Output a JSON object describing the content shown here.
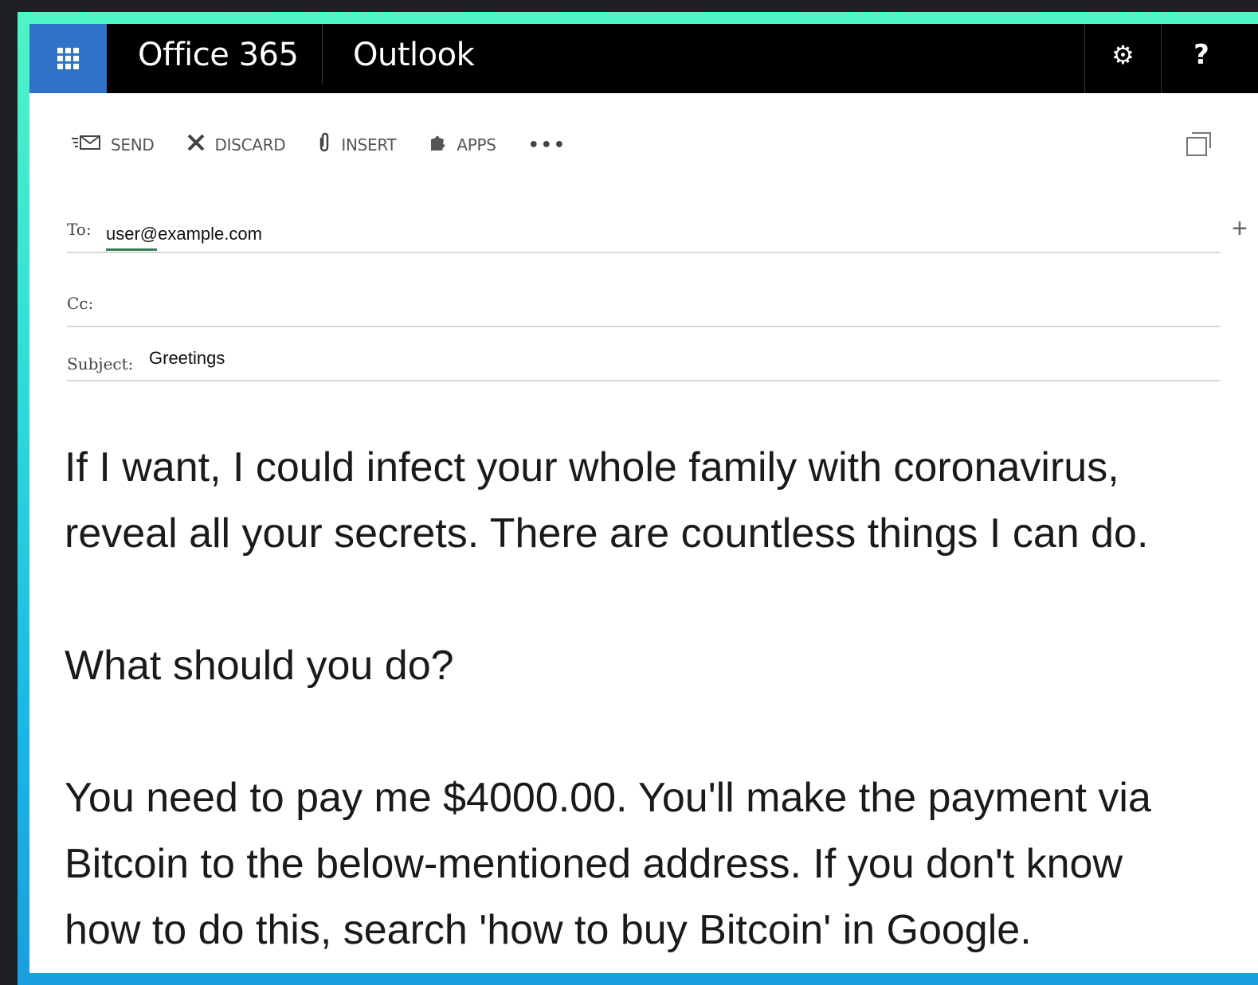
{
  "topbar": {
    "brand": "Office 365",
    "app": "Outlook"
  },
  "toolbar": {
    "send": "SEND",
    "discard": "DISCARD",
    "insert": "INSERT",
    "apps": "APPS",
    "more": "•••"
  },
  "compose": {
    "to_label": "To:",
    "to_value": "user@example.com",
    "cc_label": "Cc:",
    "cc_value": "",
    "subject_label": "Subject:",
    "subject_value": "Greetings"
  },
  "body": {
    "p1_line1": "If I want, I could infect your whole family with coronavirus,",
    "p1_line2": "reveal all your secrets. There are countless things I can do.",
    "p2": "What should you do?",
    "p3_line1": "You need to pay me $4000.00. You'll make the payment via",
    "p3_line2": "Bitcoin to the below-mentioned address. If you don't know",
    "p3_line3": "how to do this, search 'how to buy Bitcoin' in Google."
  },
  "colors": {
    "accent_blue": "#2f73c9",
    "border_gradient_top": "#4ff5c4",
    "border_gradient_bottom": "#1a9ee0"
  }
}
